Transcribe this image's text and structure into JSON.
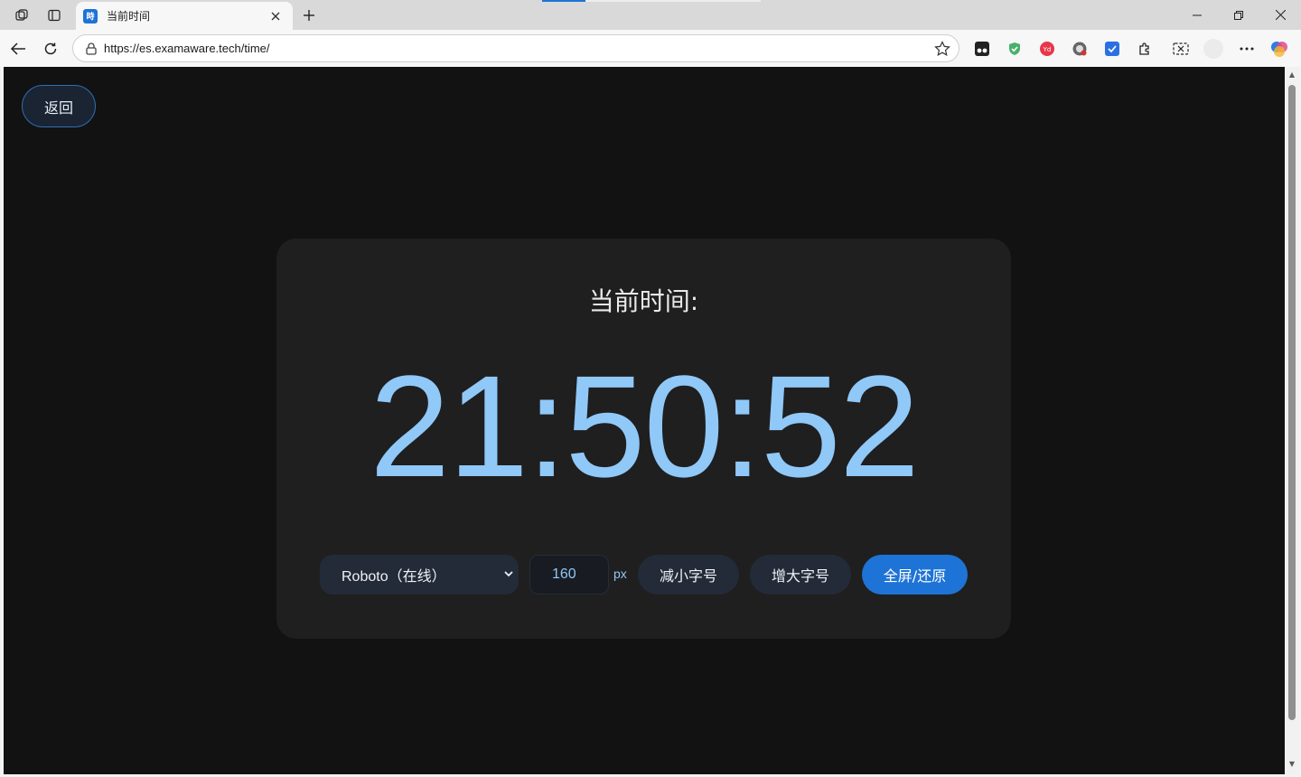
{
  "browser": {
    "tab": {
      "title": "当前时间",
      "favicon": "examaware-favicon"
    },
    "url": "https://es.examaware.tech/time/",
    "extensions": [
      "tampermonkey-icon",
      "adguard-shield-icon",
      "youdao-icon",
      "privacy-badger-icon",
      "bookmark-blue-icon",
      "puzzle-extensions-icon",
      "screenshot-icon",
      "profile-avatar-icon",
      "more-menu-icon",
      "copilot-icon"
    ]
  },
  "page": {
    "back_label": "返回",
    "title": "当前时间:",
    "time": "21:50:52",
    "controls": {
      "font_select": "Roboto（在线）",
      "font_size": "160",
      "unit": "px",
      "decrease_label": "减小字号",
      "increase_label": "增大字号",
      "fullscreen_label": "全屏/还原"
    }
  },
  "colors": {
    "page_bg": "#121212",
    "card_bg": "#1f1f1f",
    "clock": "#90c8f8",
    "accent": "#1e73d6",
    "button_bg": "#232b38"
  }
}
